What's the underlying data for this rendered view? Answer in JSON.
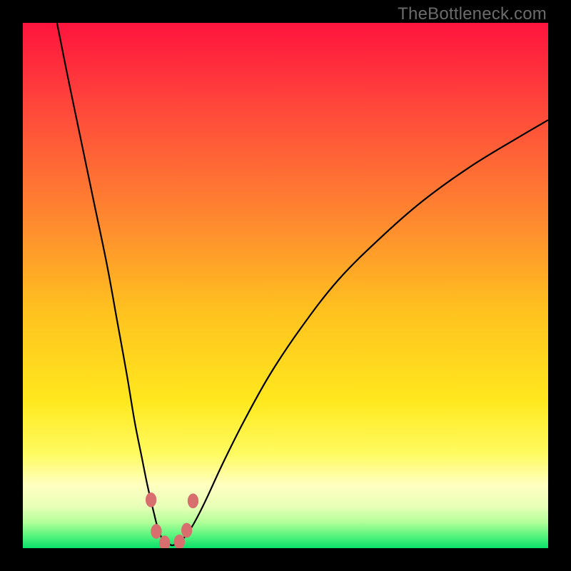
{
  "watermark": "TheBottleneck.com",
  "colors": {
    "frame": "#000000",
    "watermark": "#6b6b6b",
    "curve": "#000000",
    "marker": "#d86e6e"
  },
  "chart_data": {
    "type": "line",
    "title": "",
    "xlabel": "",
    "ylabel": "",
    "xlim": [
      0,
      100
    ],
    "ylim": [
      0,
      100
    ],
    "gradient_stops": [
      {
        "offset": 0.0,
        "color": "#ff143e"
      },
      {
        "offset": 0.18,
        "color": "#ff4d3a"
      },
      {
        "offset": 0.38,
        "color": "#ff8a2f"
      },
      {
        "offset": 0.55,
        "color": "#ffc21f"
      },
      {
        "offset": 0.72,
        "color": "#ffe81e"
      },
      {
        "offset": 0.82,
        "color": "#fffb60"
      },
      {
        "offset": 0.88,
        "color": "#ffffc0"
      },
      {
        "offset": 0.92,
        "color": "#e8ffb8"
      },
      {
        "offset": 0.95,
        "color": "#b4ff9a"
      },
      {
        "offset": 0.975,
        "color": "#5cf57e"
      },
      {
        "offset": 1.0,
        "color": "#09e06a"
      }
    ],
    "series": [
      {
        "name": "left-branch",
        "x": [
          6.5,
          8.5,
          11,
          13.5,
          16,
          18,
          19.8,
          21.3,
          22.6,
          23.6,
          24.4,
          25,
          25.5,
          26,
          26.5,
          27.2,
          28.5
        ],
        "y": [
          100,
          90,
          78,
          66,
          54,
          43,
          33,
          24,
          17.5,
          12.5,
          9,
          6.5,
          4.5,
          3,
          1.8,
          1,
          0.5
        ]
      },
      {
        "name": "right-branch",
        "x": [
          28.5,
          30,
          31.5,
          33,
          35,
          38,
          42,
          47,
          53,
          60,
          68,
          76,
          85,
          94,
          100
        ],
        "y": [
          0.5,
          1.3,
          3,
          5.5,
          9.5,
          16,
          24,
          33,
          42,
          51,
          59,
          66,
          72.5,
          78,
          81.5
        ]
      }
    ],
    "markers": [
      {
        "x": 24.4,
        "y": 9.2
      },
      {
        "x": 25.4,
        "y": 3.2
      },
      {
        "x": 27.0,
        "y": 1.0
      },
      {
        "x": 29.8,
        "y": 1.2
      },
      {
        "x": 31.2,
        "y": 3.4
      },
      {
        "x": 32.4,
        "y": 9.0
      }
    ],
    "marker_radius_px": 9
  }
}
